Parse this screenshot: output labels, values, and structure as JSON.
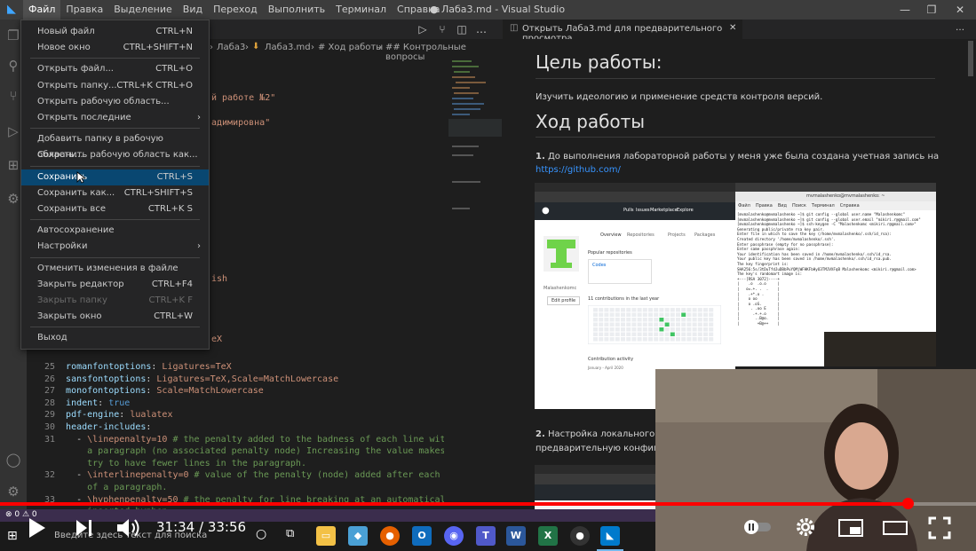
{
  "titlebar": {
    "menu": [
      "Файл",
      "Правка",
      "Выделение",
      "Вид",
      "Переход",
      "Выполнить",
      "Терминал",
      "Справка"
    ],
    "window_title": "● Лаба3.md - Visual Studio Code"
  },
  "file_menu": {
    "groups": [
      [
        {
          "label": "Новый файл",
          "shortcut": "CTRL+N"
        },
        {
          "label": "Новое окно",
          "shortcut": "CTRL+SHIFT+N"
        }
      ],
      [
        {
          "label": "Открыть файл...",
          "shortcut": "CTRL+O"
        },
        {
          "label": "Открыть папку...",
          "shortcut": "CTRL+K CTRL+O"
        },
        {
          "label": "Открыть рабочую область...",
          "shortcut": ""
        },
        {
          "label": "Открыть последние",
          "shortcut": "",
          "submenu": true
        }
      ],
      [
        {
          "label": "Добавить папку в рабочую область...",
          "shortcut": ""
        },
        {
          "label": "Сохранить рабочую область как...",
          "shortcut": ""
        }
      ],
      [
        {
          "label": "Сохранить",
          "shortcut": "CTRL+S",
          "selected": true
        },
        {
          "label": "Сохранить как...",
          "shortcut": "CTRL+SHIFT+S"
        },
        {
          "label": "Сохранить все",
          "shortcut": "CTRL+K S"
        }
      ],
      [
        {
          "label": "Автосохранение",
          "shortcut": ""
        },
        {
          "label": "Настройки",
          "shortcut": "",
          "submenu": true
        }
      ],
      [
        {
          "label": "Отменить изменения в файле",
          "shortcut": ""
        },
        {
          "label": "Закрыть редактор",
          "shortcut": "CTRL+F4"
        },
        {
          "label": "Закрыть папку",
          "shortcut": "CTRL+K F",
          "disabled": true
        },
        {
          "label": "Закрыть окно",
          "shortcut": "CTRL+W"
        }
      ],
      [
        {
          "label": "Выход",
          "shortcut": ""
        }
      ]
    ]
  },
  "breadcrumbs": [
    "Лаба3",
    "Лаба3.md",
    "# Ход работы",
    "## Контрольные вопросы"
  ],
  "editor_fragments": {
    "line_a": "й работе №2\"",
    "line_b": "адимировна\"",
    "line_c": "ish",
    "line_d": "eX"
  },
  "code_lines": [
    {
      "n": "25",
      "parts": [
        [
          "key",
          "romanfontoptions"
        ],
        [
          "plain",
          ": "
        ],
        [
          "val",
          "Ligatures=TeX"
        ]
      ]
    },
    {
      "n": "26",
      "parts": [
        [
          "key",
          "sansfontoptions"
        ],
        [
          "plain",
          ": "
        ],
        [
          "val",
          "Ligatures=TeX,Scale=MatchLowercase"
        ]
      ]
    },
    {
      "n": "27",
      "parts": [
        [
          "key",
          "monofontoptions"
        ],
        [
          "plain",
          ": "
        ],
        [
          "val",
          "Scale=MatchLowercase"
        ]
      ]
    },
    {
      "n": "28",
      "parts": [
        [
          "key",
          "indent"
        ],
        [
          "plain",
          ": "
        ],
        [
          "bool",
          "true"
        ]
      ]
    },
    {
      "n": "29",
      "parts": [
        [
          "key",
          "pdf-engine"
        ],
        [
          "plain",
          ": "
        ],
        [
          "val",
          "lualatex"
        ]
      ]
    },
    {
      "n": "30",
      "parts": [
        [
          "key",
          "header-includes"
        ],
        [
          "plain",
          ":"
        ]
      ]
    },
    {
      "n": "31",
      "parts": [
        [
          "plain",
          "  - "
        ],
        [
          "val",
          "\\linepenalty=10"
        ],
        [
          "cmt",
          " # the penalty added to the badness of each line within"
        ]
      ]
    },
    {
      "n": "",
      "parts": [
        [
          "cmt",
          "    a paragraph (no associated penalty node) Increasing the value makes tex"
        ]
      ]
    },
    {
      "n": "",
      "parts": [
        [
          "cmt",
          "    try to have fewer lines in the paragraph."
        ]
      ]
    },
    {
      "n": "32",
      "parts": [
        [
          "plain",
          "  - "
        ],
        [
          "val",
          "\\interlinepenalty=0"
        ],
        [
          "cmt",
          " # value of the penalty (node) added after each line"
        ]
      ]
    },
    {
      "n": "",
      "parts": [
        [
          "cmt",
          "    of a paragraph."
        ]
      ]
    },
    {
      "n": "33",
      "parts": [
        [
          "plain",
          "  - "
        ],
        [
          "val",
          "\\hyphenpenalty=50"
        ],
        [
          "cmt",
          " # the penalty for line breaking at an automatically"
        ]
      ]
    },
    {
      "n": "",
      "parts": [
        [
          "cmt",
          "    inserted hyphen"
        ]
      ]
    },
    {
      "n": "34",
      "parts": [
        [
          "plain",
          "  - "
        ],
        [
          "val",
          "\\exhyphenpenalty=50"
        ],
        [
          "cmt",
          " # the penalty for line breaking at an explicit"
        ]
      ]
    }
  ],
  "preview": {
    "tab_label": "Открыть Лаба3.md для предварительного просмотра",
    "h1_goal": "Цель работы:",
    "goal_text": "Изучить идеологию и применение средств контроля версий.",
    "h1_progress": "Ход работы",
    "step1_num": "1.",
    "step1_text": "До выполнения лабораторной работы у меня уже была создана учетная запись на",
    "step1_link": "https://github.com/",
    "step2_num": "2.",
    "step2_text": "Настройка локального реп",
    "step2_text_cont": "предварительную конфигурац"
  },
  "github_shot": {
    "nav": [
      "Pulls",
      "Issues",
      "Marketplace",
      "Explore"
    ],
    "tabs": [
      "Overview",
      "Repositories",
      "Projects",
      "Packages"
    ],
    "popular": "Popular repositories",
    "repo": "Codes",
    "contrib": "11 contributions in the last year",
    "activity": "Contribution activity",
    "period": "January - April 2020",
    "username": "Malashenkomc",
    "edit": "Edit profile"
  },
  "terminal_shot": {
    "title": "mvmalashenko@mvmalashenko: ~",
    "menu": [
      "Файл",
      "Правка",
      "Вид",
      "Поиск",
      "Терминал",
      "Справка"
    ],
    "lines": [
      "[mvmalashenko@mvmalashenko ~]$ git config --global user.name \"Malashenkomc\"",
      "[mvmalashenko@mvmalashenko ~]$ git config --global user.email \"mikiri.r@gmail.com\"",
      "[mvmalashenko@mvmalashenko ~]$ ssh-keygen -C \"Malashenkomc <mikiri.r@gmail.com>\"",
      "Generating public/private rsa key pair.",
      "Enter file in which to save the key (/home/mvmalashenko/.ssh/id_rsa):",
      "Created directory '/home/mvmalashenko/.ssh'.",
      "Enter passphrase (empty for no passphrase):",
      "Enter same passphrase again:",
      "Your identification has been saved in /home/mvmalashenko/.ssh/id_rsa.",
      "Your public key has been saved in /home/mvmalashenko/.ssh/id_rsa.pub.",
      "The key fingerprint is:",
      "SHA256:5s/3tDuTfdJuDBbPuYQMjWFHKFbHyO3TMJVXFqB Malashenkomc <mikiri.r@gmail.com>",
      "The key's randomart image is:",
      "+---[RSA 3072]----+",
      "|    .o  .o.o     |",
      "|   o=.+. .  .    |",
      "|    .+*.o .      |",
      "|    o oo         |",
      "|    o .oS.       |",
      "|     . .oo E     |",
      "|      .+.+.o     |",
      "|       ..B@o.    |",
      "|        +B@++    |"
    ]
  },
  "statusbar": {
    "problems": "⊗ 0 ⚠ 0"
  },
  "taskbar": {
    "search_placeholder": "Введите здесь текст для поиска"
  },
  "video": {
    "time": "31:34 / 33:56",
    "progress": 0.93
  },
  "colors": {
    "menu_selected": "#094771",
    "statusbar": "#3b2d4d",
    "progress": "#ff0000",
    "link": "#3794ff"
  }
}
